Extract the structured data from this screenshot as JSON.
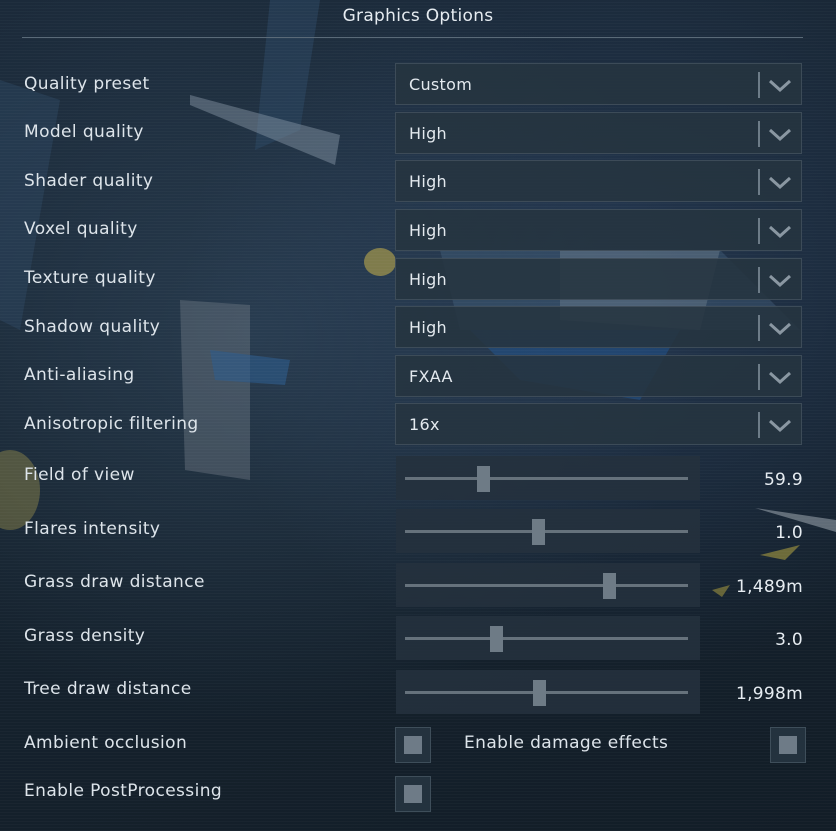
{
  "title": "Graphics Options",
  "dropdowns": [
    {
      "label": "Quality preset",
      "value": "Custom"
    },
    {
      "label": "Model quality",
      "value": "High"
    },
    {
      "label": "Shader quality",
      "value": "High"
    },
    {
      "label": "Voxel quality",
      "value": "High"
    },
    {
      "label": "Texture quality",
      "value": "High"
    },
    {
      "label": "Shadow quality",
      "value": "High"
    },
    {
      "label": "Anti-aliasing",
      "value": "FXAA"
    },
    {
      "label": "Anisotropic filtering",
      "value": "16x"
    }
  ],
  "sliders": [
    {
      "label": "Field of view",
      "value_text": "59.9",
      "fraction": 0.275
    },
    {
      "label": "Flares intensity",
      "value_text": "1.0",
      "fraction": 0.47
    },
    {
      "label": "Grass draw distance",
      "value_text": "1,489m",
      "fraction": 0.72
    },
    {
      "label": "Grass density",
      "value_text": "3.0",
      "fraction": 0.32
    },
    {
      "label": "Tree draw distance",
      "value_text": "1,998m",
      "fraction": 0.475
    }
  ],
  "checkboxes": {
    "ambient_occlusion": {
      "label": "Ambient occlusion",
      "checked": false
    },
    "damage_effects": {
      "label": "Enable damage effects",
      "checked": false
    },
    "post_processing": {
      "label": "Enable PostProcessing",
      "checked": false
    }
  },
  "icons": {
    "dropdown_arrow": "chevron-down-icon"
  },
  "colors": {
    "background": "#16232f",
    "control": "#26343f",
    "thumb": "#6e7b86",
    "text": "#dde4ea"
  }
}
